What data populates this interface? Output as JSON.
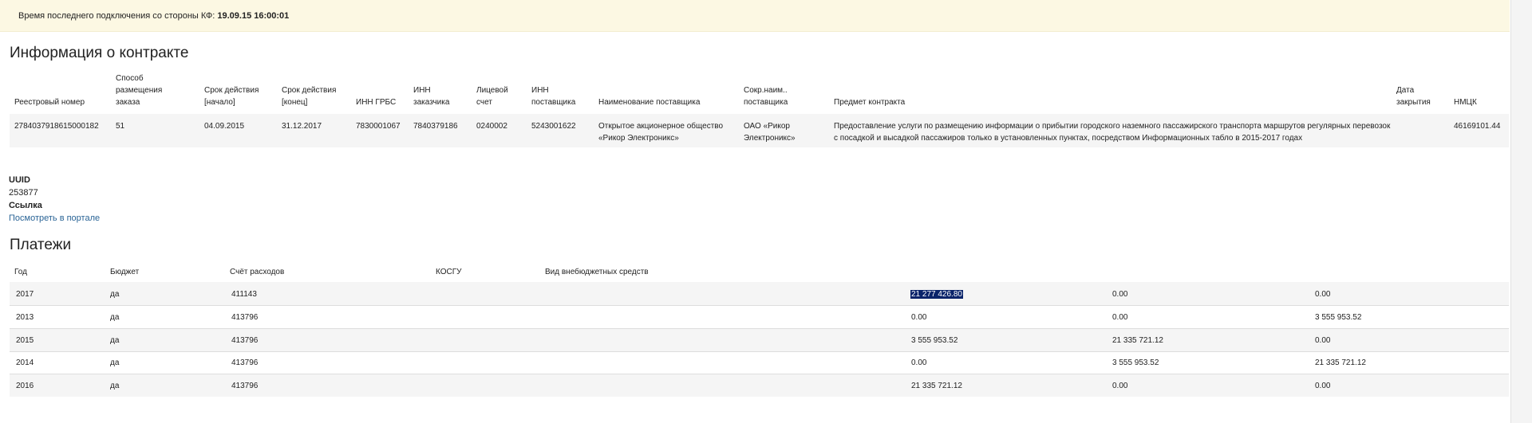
{
  "banner": {
    "label": "Время последнего подключения со стороны КФ: ",
    "timestamp": "19.09.15 16:00:01"
  },
  "contract": {
    "heading": "Информация о контракте",
    "headers": {
      "reg_number": "Реестровый номер",
      "method": "Способ размещения заказа",
      "start": "Срок действия [начало]",
      "end": "Срок действия [конец]",
      "inn_grbs": "ИНН ГРБС",
      "inn_customer": "ИНН заказчика",
      "account": "Лицевой счет",
      "inn_supplier": "ИНН поставщика",
      "supplier_name": "Наименование поставщика",
      "supplier_short": "Сокр.наим.. поставщика",
      "subject": "Предмет контракта",
      "close_date": "Дата закрытия",
      "nmck": "НМЦК"
    },
    "row": {
      "reg_number": "2784037918615000182",
      "method": "51",
      "start": "04.09.2015",
      "end": "31.12.2017",
      "inn_grbs": "7830001067",
      "inn_customer": "7840379186",
      "account": "0240002",
      "inn_supplier": "5243001622",
      "supplier_name": "Открытое акционерное общество «Рикор Электроникс»",
      "supplier_short": "ОАО «Рикор Электроникс»",
      "subject": "Предоставление услуги по размещению информации о прибытии городского наземного пассажирского транспорта маршрутов регулярных перевозок с посадкой и высадкой пассажиров только в установленных пунктах, посредством Информационных табло в 2015-2017 годах",
      "close_date": "",
      "nmck": "46169101.44"
    }
  },
  "meta": {
    "uuid_label": "UUID",
    "uuid_value": "253877",
    "link_label": "Ссылка",
    "link_text": "Посмотреть в портале"
  },
  "payments": {
    "heading": "Платежи",
    "headers": {
      "year": "Год",
      "budget": "Бюджет",
      "account": "Счёт расходов",
      "kosgu": "КОСГУ",
      "offbudget": "Вид внебюджетных средств"
    },
    "rows": [
      {
        "year": "2017",
        "budget": "да",
        "account": "411143",
        "v1": "21 277 426.80",
        "v2": "0.00",
        "v3": "0.00"
      },
      {
        "year": "2013",
        "budget": "да",
        "account": "413796",
        "v1": "0.00",
        "v2": "0.00",
        "v3": "3 555 953.52"
      },
      {
        "year": "2015",
        "budget": "да",
        "account": "413796",
        "v1": "3 555 953.52",
        "v2": "21 335 721.12",
        "v3": "0.00"
      },
      {
        "year": "2014",
        "budget": "да",
        "account": "413796",
        "v1": "0.00",
        "v2": "3 555 953.52",
        "v3": "21 335 721.12"
      },
      {
        "year": "2016",
        "budget": "да",
        "account": "413796",
        "v1": "21 335 721.12",
        "v2": "0.00",
        "v3": "0.00"
      }
    ]
  }
}
